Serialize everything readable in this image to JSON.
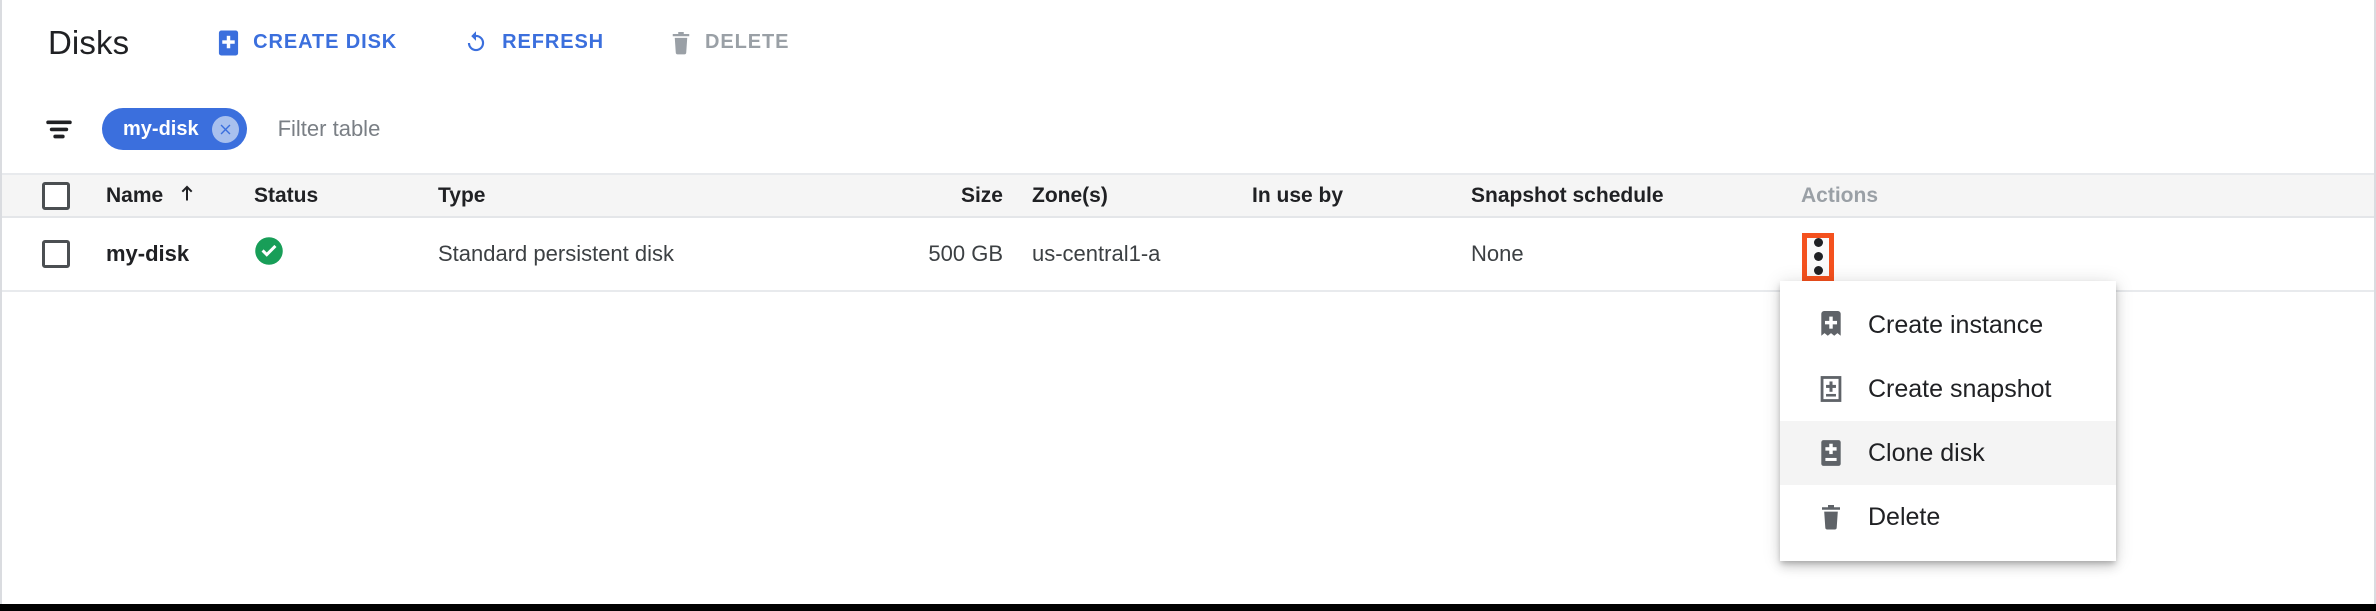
{
  "header": {
    "title": "Disks",
    "actions": [
      {
        "label": "CREATE DISK",
        "icon": "create-disk-icon",
        "disabled": false
      },
      {
        "label": "REFRESH",
        "icon": "refresh-icon",
        "disabled": false
      },
      {
        "label": "DELETE",
        "icon": "trash-icon",
        "disabled": true
      }
    ]
  },
  "filter_bar": {
    "filter_icon": "filter-list-icon",
    "chip": {
      "label": "my-disk",
      "remove_icon": "chip-remove-icon"
    },
    "input_placeholder": "Filter table",
    "input_value": ""
  },
  "table": {
    "columns": [
      {
        "key": "checkbox",
        "label": ""
      },
      {
        "key": "name",
        "label": "Name",
        "sort_icon": "sort-ascending-arrow-icon"
      },
      {
        "key": "status",
        "label": "Status"
      },
      {
        "key": "type",
        "label": "Type"
      },
      {
        "key": "size",
        "label": "Size"
      },
      {
        "key": "zone",
        "label": "Zone(s)"
      },
      {
        "key": "in_use_by",
        "label": "In use by"
      },
      {
        "key": "snapshot",
        "label": "Snapshot schedule"
      },
      {
        "key": "actions",
        "label": "Actions"
      }
    ],
    "rows": [
      {
        "selected": false,
        "name": "my-disk",
        "status_icon": "status-ok-check-icon",
        "type": "Standard persistent disk",
        "size": "500 GB",
        "zone": "us-central1-a",
        "in_use_by": "",
        "snapshot_schedule": "None",
        "actions_icon": "more-vert-kebab-icon"
      }
    ]
  },
  "row_menu": {
    "items": [
      {
        "label": "Create instance",
        "icon": "create-instance-icon",
        "hover": false
      },
      {
        "label": "Create snapshot",
        "icon": "create-snapshot-icon",
        "hover": false
      },
      {
        "label": "Clone disk",
        "icon": "clone-disk-icon",
        "hover": true
      },
      {
        "label": "Delete",
        "icon": "trash-icon",
        "hover": false
      }
    ]
  },
  "colors": {
    "accent_blue": "#3b6fdd",
    "status_green": "#189e58",
    "highlight_orange": "#f4511e",
    "disabled_grey": "#9aa0a6",
    "header_row_bg": "#f5f5f5"
  }
}
